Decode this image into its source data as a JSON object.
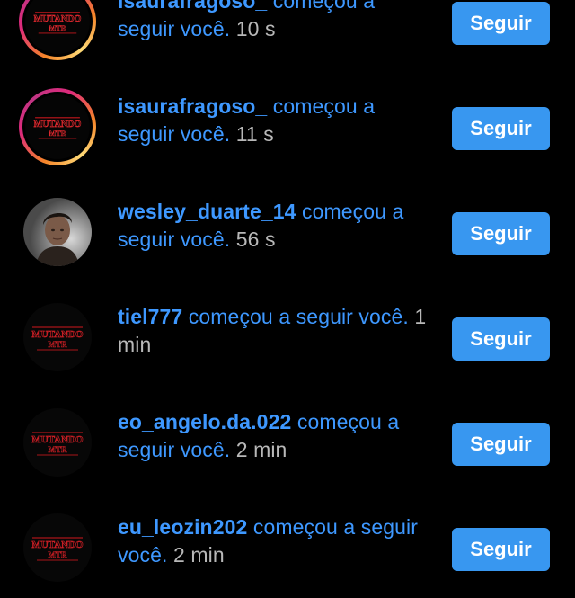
{
  "notifications": [
    {
      "username": "isaurafragoso_",
      "action": " começou a seguir você.",
      "time": " 10 s",
      "button_label": "Seguir",
      "avatar": "stranger-things-logo",
      "story_ring": true
    },
    {
      "username": "isaurafragoso_",
      "action": " começou a seguir você.",
      "time": " 11 s",
      "button_label": "Seguir",
      "avatar": "stranger-things-logo",
      "story_ring": true
    },
    {
      "username": "wesley_duarte_14",
      "action": " começou a seguir você.",
      "time": " 56 s",
      "button_label": "Seguir",
      "avatar": "person-photo",
      "story_ring": false
    },
    {
      "username": "tiel777",
      "action": " começou a seguir você.",
      "time": " 1 min",
      "button_label": "Seguir",
      "avatar": "stranger-things-logo",
      "story_ring": false
    },
    {
      "username": "eo_angelo.da.022",
      "action": " começou a seguir você.",
      "time": " 2 min",
      "button_label": "Seguir",
      "avatar": "stranger-things-logo",
      "story_ring": false
    },
    {
      "username": "eu_leozin202",
      "action": " começou a seguir você.",
      "time": " 2 min",
      "button_label": "Seguir",
      "avatar": "stranger-things-logo",
      "story_ring": false
    }
  ],
  "avatar_logo_text": [
    "MUTANDO",
    "MTR"
  ],
  "colors": {
    "background": "#000000",
    "link_blue": "#3e98ff",
    "button_blue": "#3897f0",
    "time_gray": "#b8b8b8",
    "logo_red": "#c4161c"
  }
}
